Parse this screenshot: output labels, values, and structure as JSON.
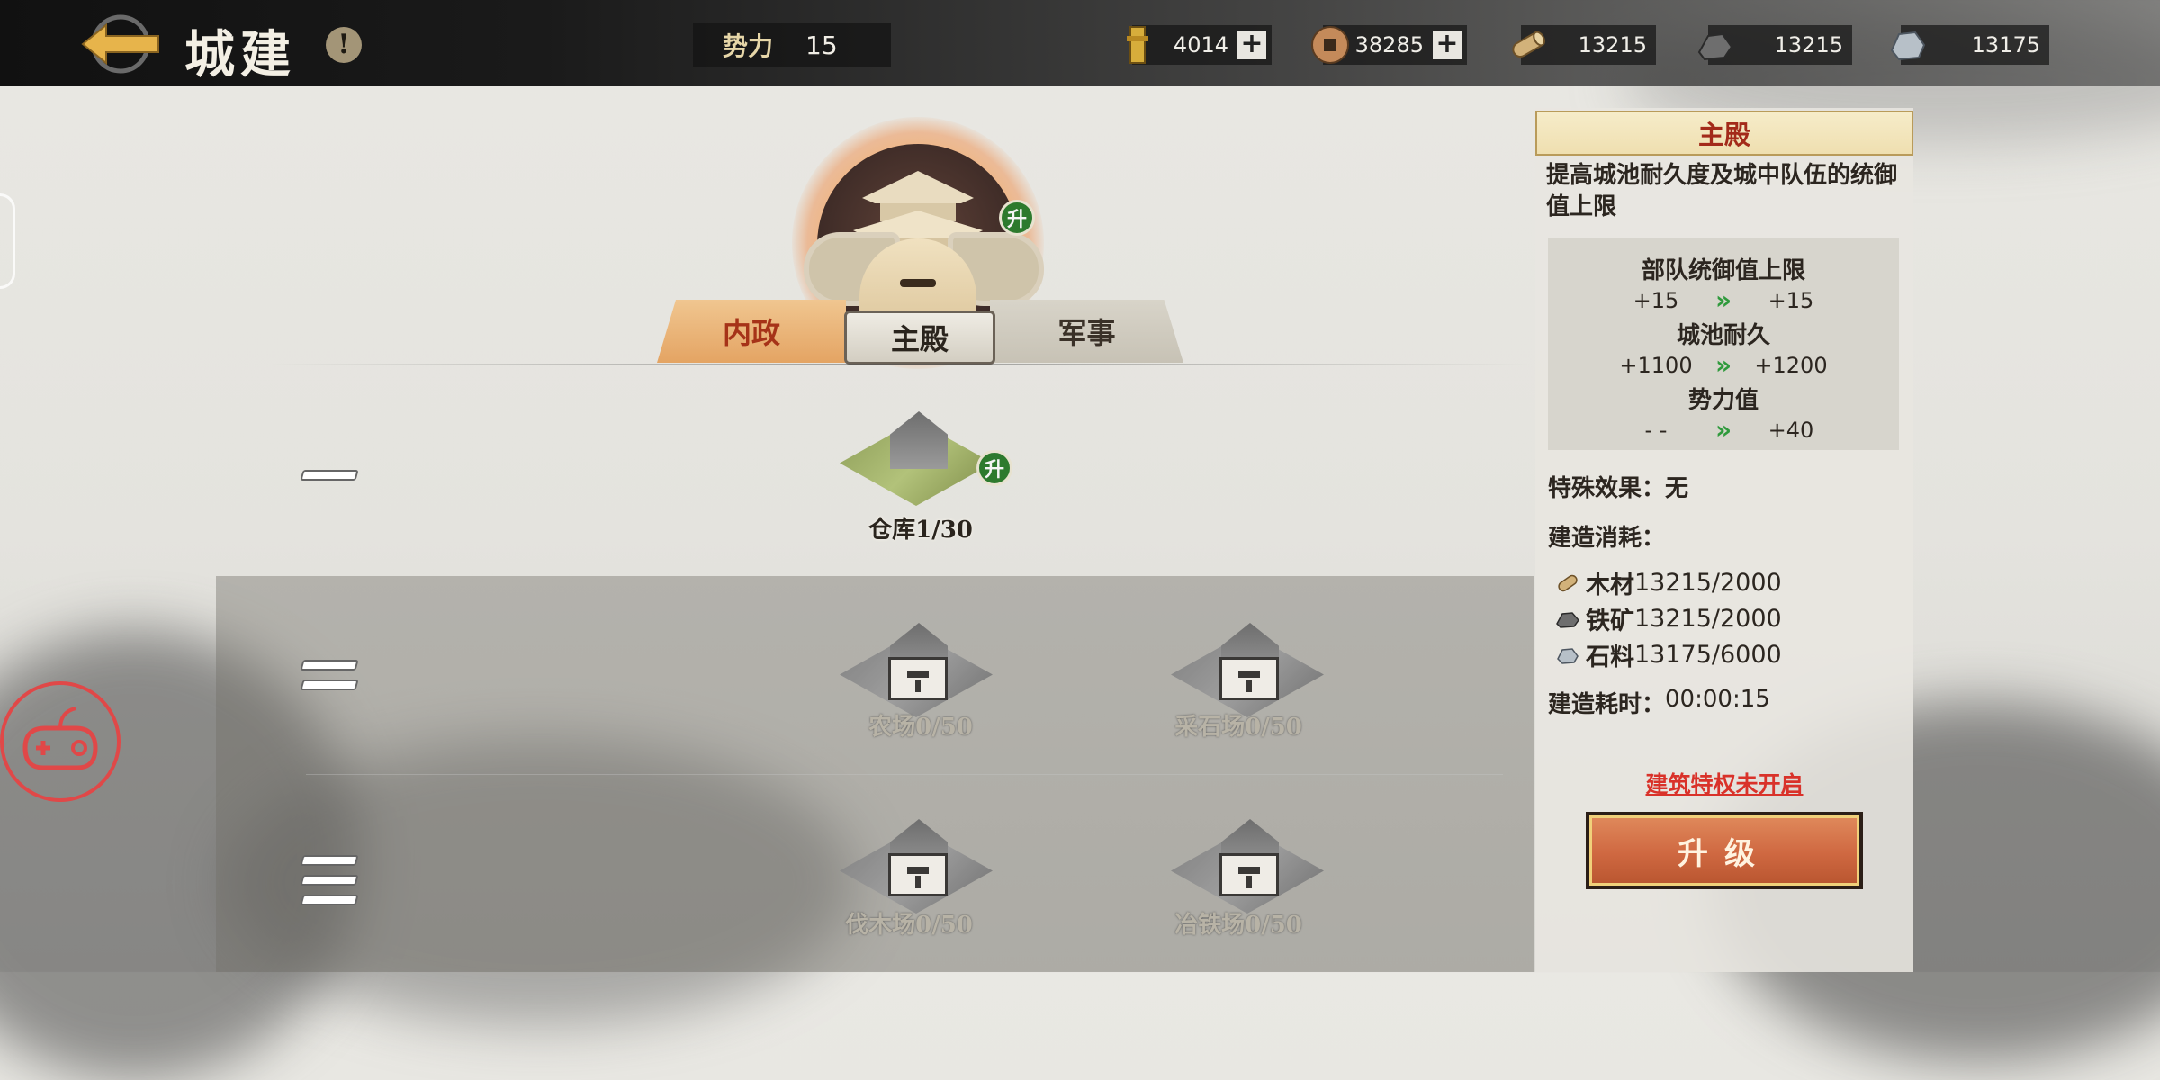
{
  "header": {
    "title": "城建",
    "info_icon_glyph": "!",
    "power_label": "势力",
    "power_value": "15"
  },
  "resources": [
    {
      "icon": "token-icon",
      "value": "4014",
      "has_plus": true
    },
    {
      "icon": "coin-icon",
      "value": "38285",
      "has_plus": true
    },
    {
      "icon": "wood-icon",
      "value": "13215",
      "has_plus": false
    },
    {
      "icon": "iron-icon",
      "value": "13215",
      "has_plus": false
    },
    {
      "icon": "stone-icon",
      "value": "13175",
      "has_plus": false
    }
  ],
  "plus_glyph": "+",
  "tabs": {
    "left": "内政",
    "center": "主殿",
    "right": "军事"
  },
  "upgrade_badge_glyph": "升",
  "buildings": {
    "warehouse": "仓库1/30",
    "farm": "农场0/50",
    "quarry": "采石场0/50",
    "lumber": "伐木场0/50",
    "smelter": "冶铁场0/50"
  },
  "panel": {
    "title": "主殿",
    "description": "提高城池耐久度及城中队伍的统御值上限",
    "stats": [
      {
        "label": "部队统御值上限",
        "current": "+15",
        "next": "+15"
      },
      {
        "label": "城池耐久",
        "current": "+1100",
        "next": "+1200"
      },
      {
        "label": "势力值",
        "current": "- -",
        "next": "+40"
      }
    ],
    "arrow_glyph": "»",
    "special_effect": "特殊效果：无",
    "cost_title": "建造消耗：",
    "costs": [
      {
        "name": "木材",
        "amount": "13215/2000"
      },
      {
        "name": "铁矿",
        "amount": "13215/2000"
      },
      {
        "name": "石料",
        "amount": "13175/6000"
      }
    ],
    "build_time_label": "建造耗时：",
    "build_time_value": "00:00:15",
    "privilege_link": "建筑特权未开启",
    "upgrade_button": "升级"
  },
  "colors": {
    "accent_red": "#a32a1a",
    "upgrade_green": "#2d7a2d",
    "button_orange": "#cf6841",
    "link_red": "#d9322a"
  }
}
